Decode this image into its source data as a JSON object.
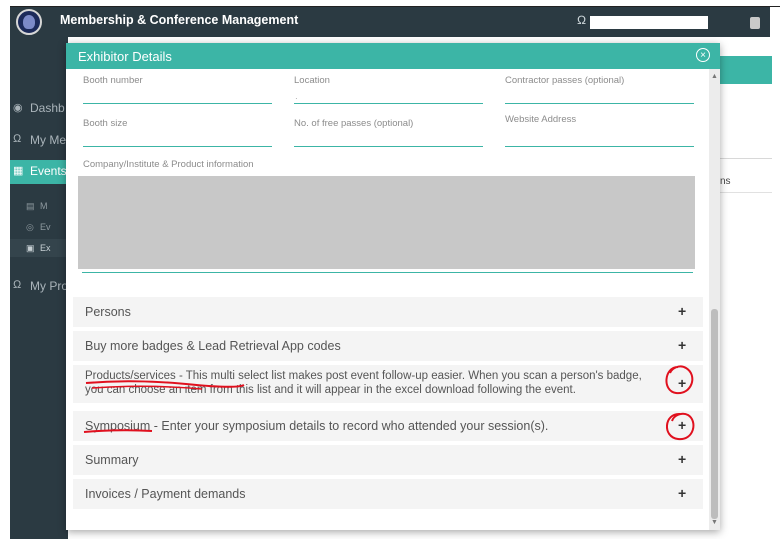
{
  "app": {
    "title": "Membership & Conference Management"
  },
  "sidebar": {
    "items": [
      {
        "label": "Dashb",
        "icon": "dashboard-icon"
      },
      {
        "label": "My Me",
        "icon": "user-icon"
      },
      {
        "label": "Events",
        "icon": "calendar-icon"
      },
      {
        "label": "My Pro",
        "icon": "user-icon"
      }
    ],
    "subitems": [
      {
        "label": "M",
        "icon": "list-icon"
      },
      {
        "label": "Ev",
        "icon": "globe-icon"
      },
      {
        "label": "Ex",
        "icon": "database-icon"
      }
    ]
  },
  "background": {
    "truncated_text": "ns"
  },
  "modal": {
    "title": "Exhibitor Details",
    "fields": {
      "booth_number": "Booth number",
      "location": "Location",
      "contractor_passes": "Contractor passes (optional)",
      "booth_size": "Booth size",
      "free_passes": "No. of free passes (optional)",
      "website": "Website Address",
      "company_info": "Company/Institute & Product information"
    },
    "accordion": {
      "persons": "Persons",
      "badges": "Buy more badges & Lead Retrieval App codes",
      "products_line1": "Products/services - This multi select list makes post event follow-up easier. When you scan a person's badge,",
      "products_line2": "you can choose an item from this list and it will appear in the excel download following the event.",
      "symposium": "Symposium - Enter your symposium details to record who attended your session(s).",
      "summary": "Summary",
      "invoices": "Invoices / Payment demands",
      "plus": "+"
    }
  },
  "colors": {
    "accent": "#3cb5a6",
    "sidebar": "#2b3a42",
    "annotation": "#e0101e"
  }
}
